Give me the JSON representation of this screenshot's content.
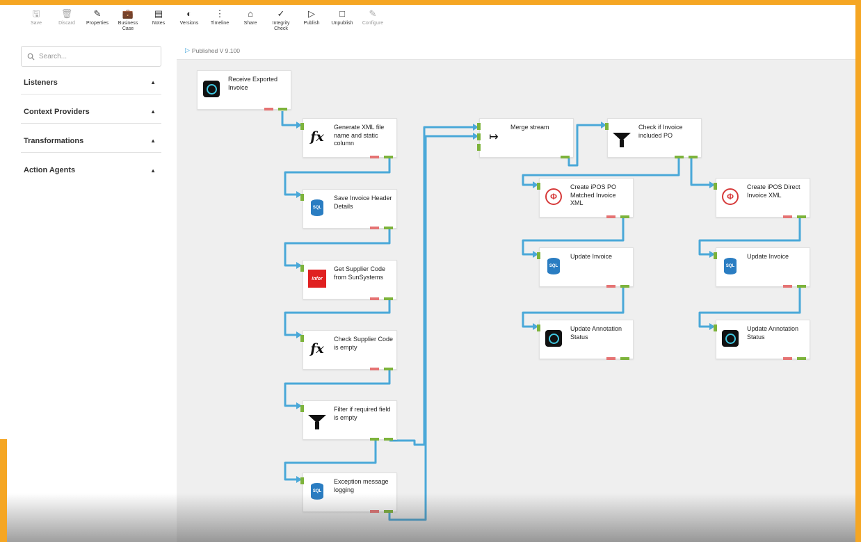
{
  "toolbar": {
    "buttons": [
      {
        "label": "Save",
        "icon": "save-icon",
        "glyph": "🖫",
        "enabled": false
      },
      {
        "label": "Discard",
        "icon": "trash-icon",
        "glyph": "🗑",
        "enabled": false
      },
      {
        "label": "Properties",
        "icon": "pencil-icon",
        "glyph": "✎",
        "enabled": true
      },
      {
        "label": "Business Case",
        "icon": "briefcase-icon",
        "glyph": "💼",
        "enabled": true
      },
      {
        "label": "Notes",
        "icon": "notes-icon",
        "glyph": "▤",
        "enabled": true
      },
      {
        "label": "Versions",
        "icon": "versions-icon",
        "glyph": "◐",
        "enabled": true
      },
      {
        "label": "Timeline",
        "icon": "timeline-icon",
        "glyph": "⋮",
        "enabled": true
      },
      {
        "label": "Share",
        "icon": "share-icon",
        "glyph": "⌂",
        "enabled": true
      },
      {
        "label": "Integrity Check",
        "icon": "check-circle-icon",
        "glyph": "✓",
        "enabled": true
      },
      {
        "label": "Publish",
        "icon": "play-icon",
        "glyph": "▷",
        "enabled": true
      },
      {
        "label": "Unpublish",
        "icon": "square-icon",
        "glyph": "□",
        "enabled": true
      },
      {
        "label": "Configure",
        "icon": "pencil-icon",
        "glyph": "✎",
        "enabled": false
      }
    ]
  },
  "sidebar": {
    "search_placeholder": "Search...",
    "sections": [
      {
        "label": "Listeners",
        "caret": "▲"
      },
      {
        "label": "Context Providers",
        "caret": "▲"
      },
      {
        "label": "Transformations",
        "caret": "▲"
      },
      {
        "label": "Action Agents",
        "caret": "▲"
      }
    ]
  },
  "canvas": {
    "status": "Published V 9.100",
    "nodes": [
      {
        "id": "receive",
        "label": "Receive Exported Invoice",
        "icon": "listener-icon"
      },
      {
        "id": "genxml",
        "label": "Generate XML file name and static column",
        "icon": "fx-icon"
      },
      {
        "id": "saveinv",
        "label": "Save Invoice Header Details",
        "icon": "sql-icon"
      },
      {
        "id": "getsupp",
        "label": "Get Supplier Code from SunSystems",
        "icon": "infor-icon"
      },
      {
        "id": "checksupp",
        "label": "Check Supplier Code is empty",
        "icon": "fx-icon"
      },
      {
        "id": "filter",
        "label": "Filter if required field is empty",
        "icon": "filter-icon"
      },
      {
        "id": "exception",
        "label": "Exception message logging",
        "icon": "sql-icon"
      },
      {
        "id": "merge",
        "label": "Merge stream",
        "icon": "merge-icon"
      },
      {
        "id": "checkpo",
        "label": "Check if Invoice included PO",
        "icon": "filter-icon"
      },
      {
        "id": "createpo",
        "label": "Create iPOS PO Matched Invoice XML",
        "icon": "ipos-icon"
      },
      {
        "id": "createdirect",
        "label": "Create iPOS Direct Invoice XML",
        "icon": "ipos-icon"
      },
      {
        "id": "update1",
        "label": "Update Invoice",
        "icon": "sql-icon"
      },
      {
        "id": "update2",
        "label": "Update Invoice",
        "icon": "sql-icon"
      },
      {
        "id": "annot1",
        "label": "Update Annotation Status",
        "icon": "listener-icon"
      },
      {
        "id": "annot2",
        "label": "Update Annotation Status",
        "icon": "listener-icon"
      }
    ],
    "icon_text": {
      "sql": "SQL",
      "infor": "infor",
      "ipos": "Φ",
      "merge": "↦"
    },
    "colors": {
      "connector": "#4aa8d8",
      "port_ok": "#7db33b",
      "port_err": "#e57373",
      "accent": "#f5a623"
    }
  }
}
